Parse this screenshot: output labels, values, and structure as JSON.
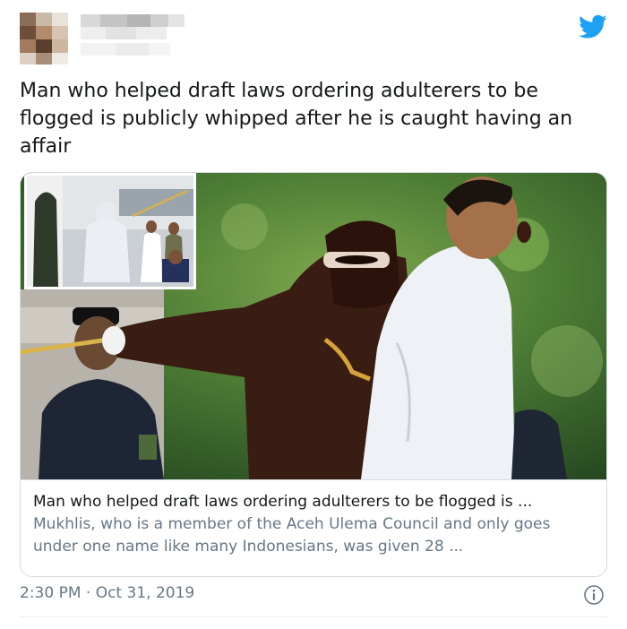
{
  "tweet": {
    "text": "Man who helped draft laws ordering adulterers to be flogged is publicly whipped after he is caught having an affair",
    "timestamp": "2:30 PM · Oct 31, 2019",
    "brand_icon": "twitter-bird-icon",
    "brand_color": "#1da1f2"
  },
  "card": {
    "title": "Man who helped draft laws ordering adulterers to be flogged is ...",
    "description": "Mukhlis, who is a member of the Aceh Ulema Council and only goes under one name like many Indonesians, was given 28 ..."
  },
  "colors": {
    "text": "#14171a",
    "muted": "#657786",
    "border": "#d4dbe0"
  }
}
